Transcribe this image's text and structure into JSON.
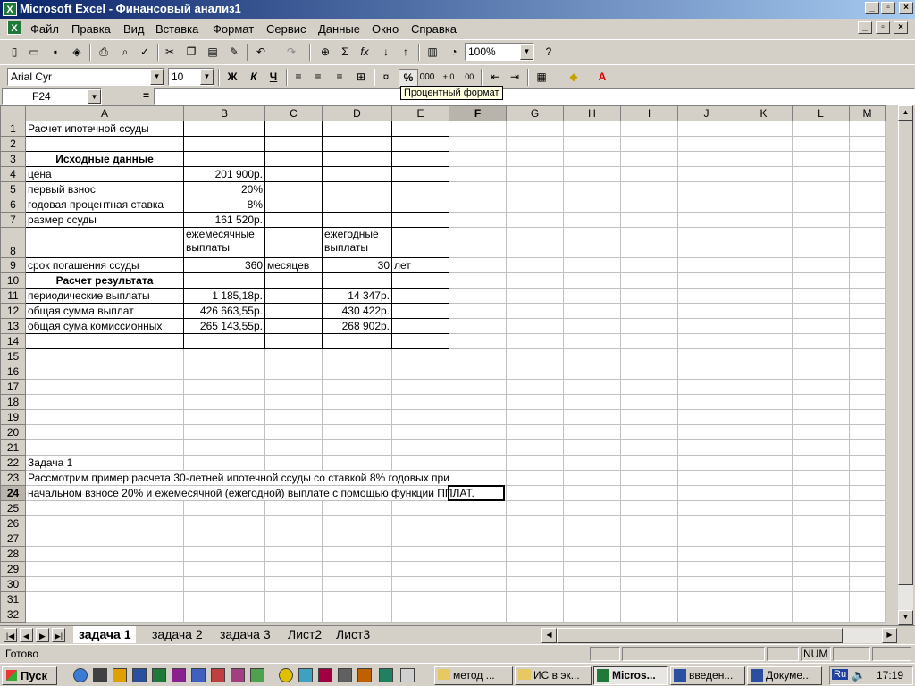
{
  "window": {
    "title": "Microsoft Excel - Финансовый анализ1"
  },
  "menu": {
    "items": [
      "Файл",
      "Правка",
      "Вид",
      "Вставка",
      "Формат",
      "Сервис",
      "Данные",
      "Окно",
      "Справка"
    ]
  },
  "toolbar": {
    "zoom": "100%",
    "font_name": "Arial Cyr",
    "font_size": "10",
    "bold": "Ж",
    "italic": "К",
    "underline": "Ч",
    "percent": "%",
    "thousands": "000",
    "sum": "Σ",
    "fx": "fx"
  },
  "tooltip": "Процентный формат",
  "formula_bar": {
    "name_box": "F24",
    "equals": "=",
    "content": ""
  },
  "columns": [
    "A",
    "B",
    "C",
    "D",
    "E",
    "F",
    "G",
    "H",
    "I",
    "J",
    "K",
    "L",
    "M"
  ],
  "rows": [
    "1",
    "2",
    "3",
    "4",
    "5",
    "6",
    "7",
    "8",
    "9",
    "10",
    "11",
    "12",
    "13",
    "14",
    "15",
    "16",
    "17",
    "18",
    "19",
    "20",
    "21",
    "22",
    "23",
    "24",
    "25",
    "26",
    "27",
    "28",
    "29",
    "30",
    "31",
    "32"
  ],
  "cells": {
    "A1": "Расчет ипотечной ссуды",
    "A3": "Исходные данные",
    "A4": "цена",
    "B4": "201 900р.",
    "A5": "первый взнос",
    "B5": "20%",
    "A6": "годовая процентная ставка",
    "B6": "8%",
    "A7": "размер ссуды",
    "B7": "161 520р.",
    "B8a": "ежемесячные",
    "B8b": "выплаты",
    "D8a": "ежегодные",
    "D8b": "выплаты",
    "A9": "срок погашения ссуды",
    "B9": "360",
    "C9": "месяцев",
    "D9": "30",
    "E9": "лет",
    "A10": "Расчет результата",
    "A11": "периодические выплаты",
    "B11": "1 185,18р.",
    "D11": "14 347р.",
    "A12": "общая сумма выплат",
    "B12": "426 663,55р.",
    "D12": "430 422р.",
    "A13": "общая сума комиссионных",
    "B13": "265 143,55р.",
    "D13": "268 902р.",
    "A22": "Задача 1",
    "A23": "Рассмотрим  пример расчета 30-летней ипотечной ссуды со ставкой 8% годовых при",
    "A24": "начальном взносе 20% и ежемесячной (ежегодной) выплате с помощью функции ППЛАТ."
  },
  "sheet_tabs": [
    "задача 1",
    "задача 2",
    "задача 3",
    "Лист2",
    "Лист3"
  ],
  "status": {
    "text": "Готово",
    "num": "NUM"
  },
  "taskbar": {
    "start": "Пуск",
    "buttons": [
      "метод ...",
      "ИС в эк...",
      "Micros...",
      "введен...",
      "Докуме..."
    ],
    "lang": "Ru",
    "clock": "17:19"
  }
}
